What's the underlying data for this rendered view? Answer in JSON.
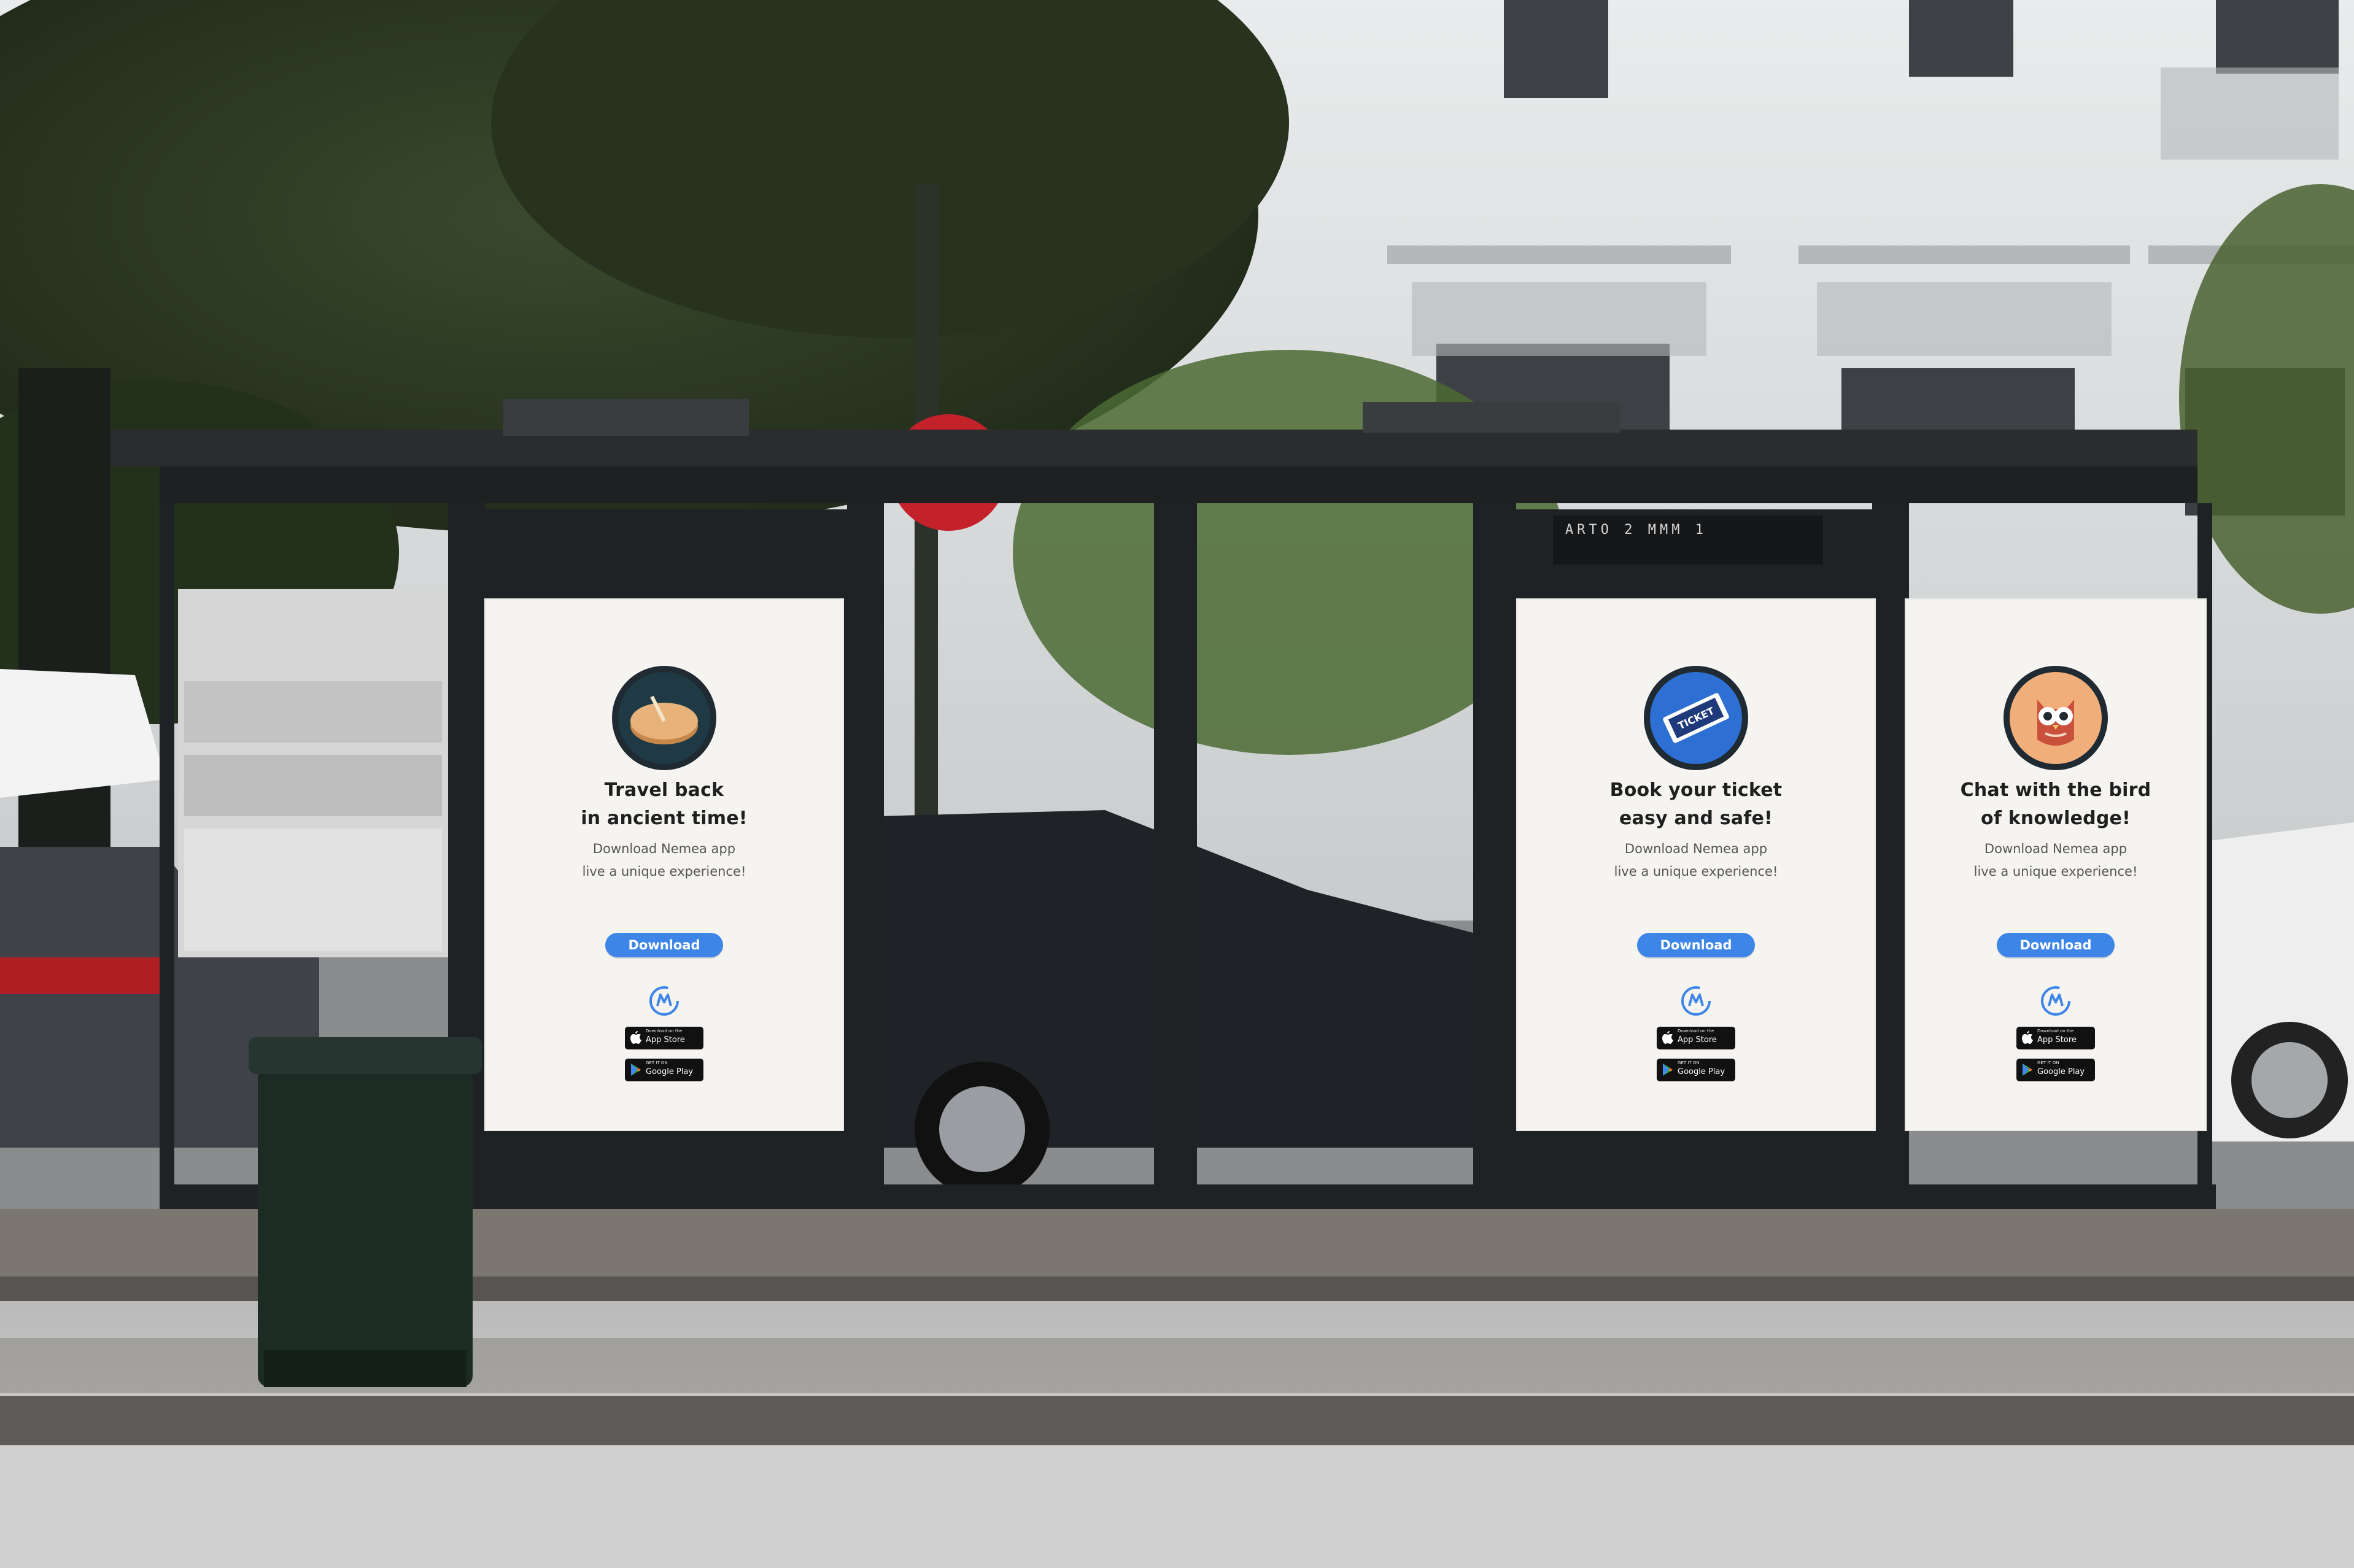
{
  "posters": [
    {
      "headline_line1": "Travel back",
      "headline_line2": "in ancient time!",
      "sub_line1": "Download Nemea app",
      "sub_line2": "live a unique experience!",
      "button": "Download",
      "icon": "sundial-icon",
      "icon_bg": "#1f3a45",
      "appstore_small": "Download on the",
      "appstore_big": "App Store",
      "googleplay_small": "GET IT ON",
      "googleplay_big": "Google Play"
    },
    {
      "headline_line1": "Book your ticket",
      "headline_line2": "easy and safe!",
      "sub_line1": "Download Nemea app",
      "sub_line2": "live a unique experience!",
      "button": "Download",
      "icon": "ticket-icon",
      "icon_bg": "#2d6fd3",
      "ticket_text": "TICKET",
      "appstore_small": "Download on the",
      "appstore_big": "App Store",
      "googleplay_small": "GET IT ON",
      "googleplay_big": "Google Play"
    },
    {
      "headline_line1": "Chat with the bird",
      "headline_line2": "of knowledge!",
      "sub_line1": "Download Nemea app",
      "sub_line2": "live a unique experience!",
      "button": "Download",
      "icon": "owl-icon",
      "icon_bg": "#f0ae7a",
      "appstore_small": "Download on the",
      "appstore_big": "App Store",
      "googleplay_small": "GET IT ON",
      "googleplay_big": "Google Play"
    }
  ],
  "colors": {
    "button": "#3d86e8",
    "poster_bg": "#f6f4f1",
    "shelter_frame": "#1f2224",
    "icon_border": "#1f2a33"
  },
  "shelter": {
    "display_text": "ARTO 2  MMM  1"
  }
}
